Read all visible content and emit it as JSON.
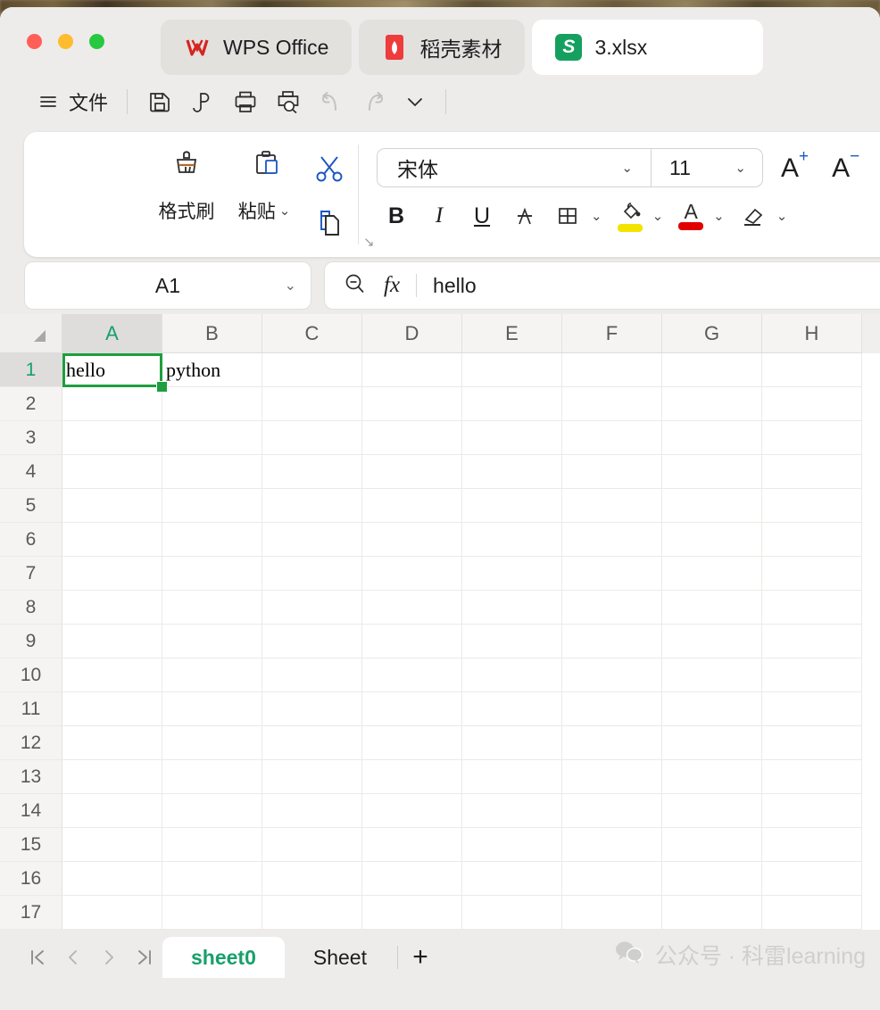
{
  "window": {
    "app_tabs": [
      {
        "label": "WPS Office",
        "icon": "wps-logo-icon",
        "active": false
      },
      {
        "label": "稻壳素材",
        "icon": "daoke-logo-icon",
        "active": false
      },
      {
        "label": "3.xlsx",
        "icon": "xlsx-file-icon",
        "active": true
      }
    ]
  },
  "quick_access": {
    "menu_icon": "hamburger-menu-icon",
    "file_label": "文件",
    "items": [
      {
        "name": "save-icon",
        "label": "保存"
      },
      {
        "name": "export-pdf-icon",
        "label": "输出为PDF"
      },
      {
        "name": "print-icon",
        "label": "打印"
      },
      {
        "name": "print-preview-icon",
        "label": "打印预览"
      },
      {
        "name": "undo-icon",
        "label": "撤销"
      },
      {
        "name": "redo-icon",
        "label": "恢复"
      },
      {
        "name": "more-chevron-icon",
        "label": "更多"
      }
    ]
  },
  "ribbon": {
    "clipboard": {
      "format_painter_label": "格式刷",
      "paste_label": "粘贴",
      "cut_label": "剪切",
      "copy_label": "复制",
      "expand_arrow": "↘"
    },
    "font": {
      "font_name": "宋体",
      "font_size": "11",
      "increase_size_label": "A",
      "increase_size_sup": "+",
      "decrease_size_label": "A",
      "decrease_size_sup": "−",
      "bold_label": "B",
      "italic_label": "I",
      "underline_label": "U",
      "strikethrough_label": "A",
      "borders_label": "边框",
      "fill_color_label": "A",
      "fill_color": "#f2e400",
      "font_color_label": "A",
      "font_color": "#e00000",
      "clear_format_label": "清除格式",
      "chevron": "⌄"
    }
  },
  "formula_bar": {
    "name_box_value": "A1",
    "name_box_chevron": "⌄",
    "zoom_icon": "magnifier-minus-icon",
    "fx_label": "fx",
    "formula_value": "hello"
  },
  "grid": {
    "columns": [
      "A",
      "B",
      "C",
      "D",
      "E",
      "F",
      "G",
      "H"
    ],
    "rows": [
      "1",
      "2",
      "3",
      "4",
      "5",
      "6",
      "7",
      "8",
      "9",
      "10",
      "11",
      "12",
      "13",
      "14",
      "15",
      "16",
      "17"
    ],
    "selected_column": "A",
    "selected_row": "1",
    "selected_cell": "A1",
    "cell_values": [
      {
        "ref": "A1",
        "row": 0,
        "col": 0,
        "value": "hello"
      },
      {
        "ref": "B1",
        "row": 0,
        "col": 1,
        "value": "python"
      }
    ],
    "selection_color": "#1e9e3e",
    "header_accent_color": "#17a06a"
  },
  "sheet_bar": {
    "nav": [
      {
        "name": "first-sheet-icon",
        "label": "|◁"
      },
      {
        "name": "prev-sheet-icon",
        "label": "‹"
      },
      {
        "name": "next-sheet-icon",
        "label": "›"
      },
      {
        "name": "last-sheet-icon",
        "label": "▷|"
      }
    ],
    "tabs": [
      {
        "label": "sheet0",
        "active": true
      },
      {
        "label": "Sheet",
        "active": false
      }
    ],
    "add_label": "+",
    "watermark": "公众号 · 科雷learning"
  }
}
